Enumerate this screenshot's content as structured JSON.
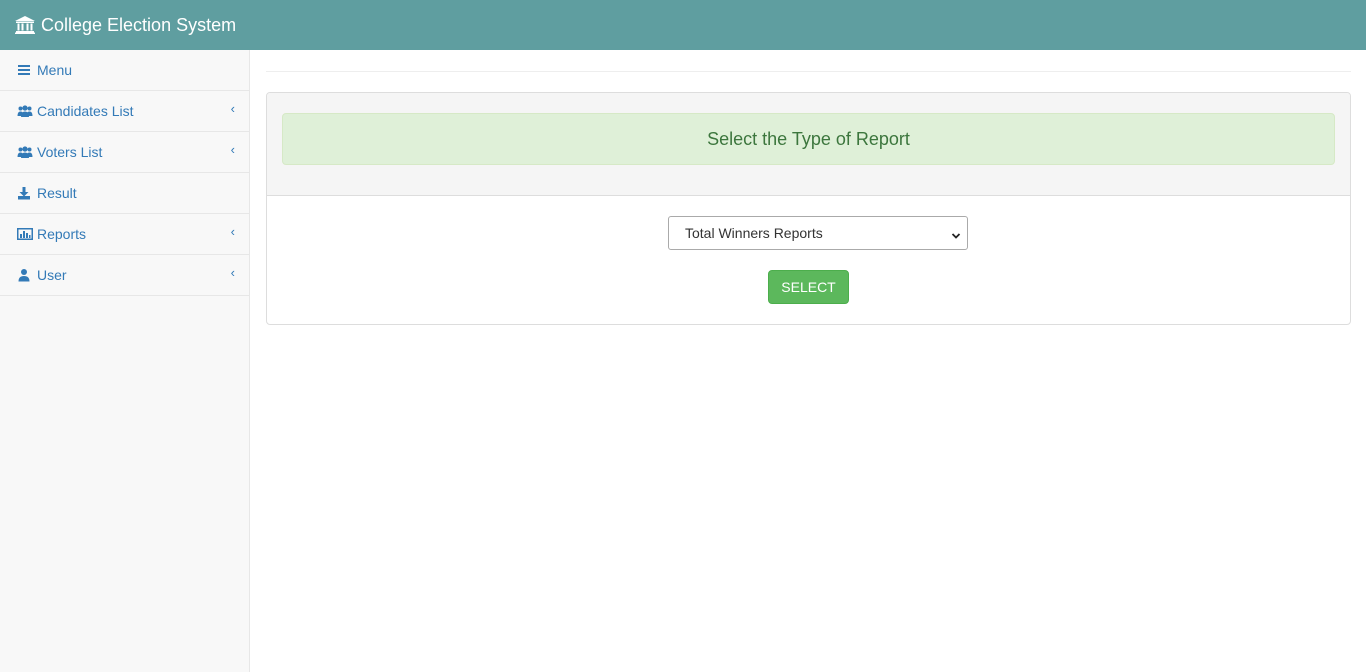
{
  "app": {
    "title": "College Election System",
    "brand_icon": "institution-icon"
  },
  "sidebar": {
    "items": [
      {
        "label": "Menu",
        "icon": "bars-icon",
        "has_chevron": false
      },
      {
        "label": "Candidates List",
        "icon": "users-icon",
        "has_chevron": true
      },
      {
        "label": "Voters List",
        "icon": "users-icon",
        "has_chevron": true
      },
      {
        "label": "Result",
        "icon": "download-icon",
        "has_chevron": false
      },
      {
        "label": "Reports",
        "icon": "bar-chart-icon",
        "has_chevron": true
      },
      {
        "label": "User",
        "icon": "user-icon",
        "has_chevron": true
      }
    ],
    "chevron_glyph": "‹"
  },
  "main": {
    "heading": "Select the Type of Report",
    "report_select": {
      "selected": "Total Winners Reports"
    },
    "select_button": "SELECT"
  },
  "colors": {
    "topbar": "#5f9ea0",
    "link": "#337ab7",
    "success_bg": "#dff0d8",
    "success_text": "#3c763d",
    "button": "#5cb85c"
  }
}
